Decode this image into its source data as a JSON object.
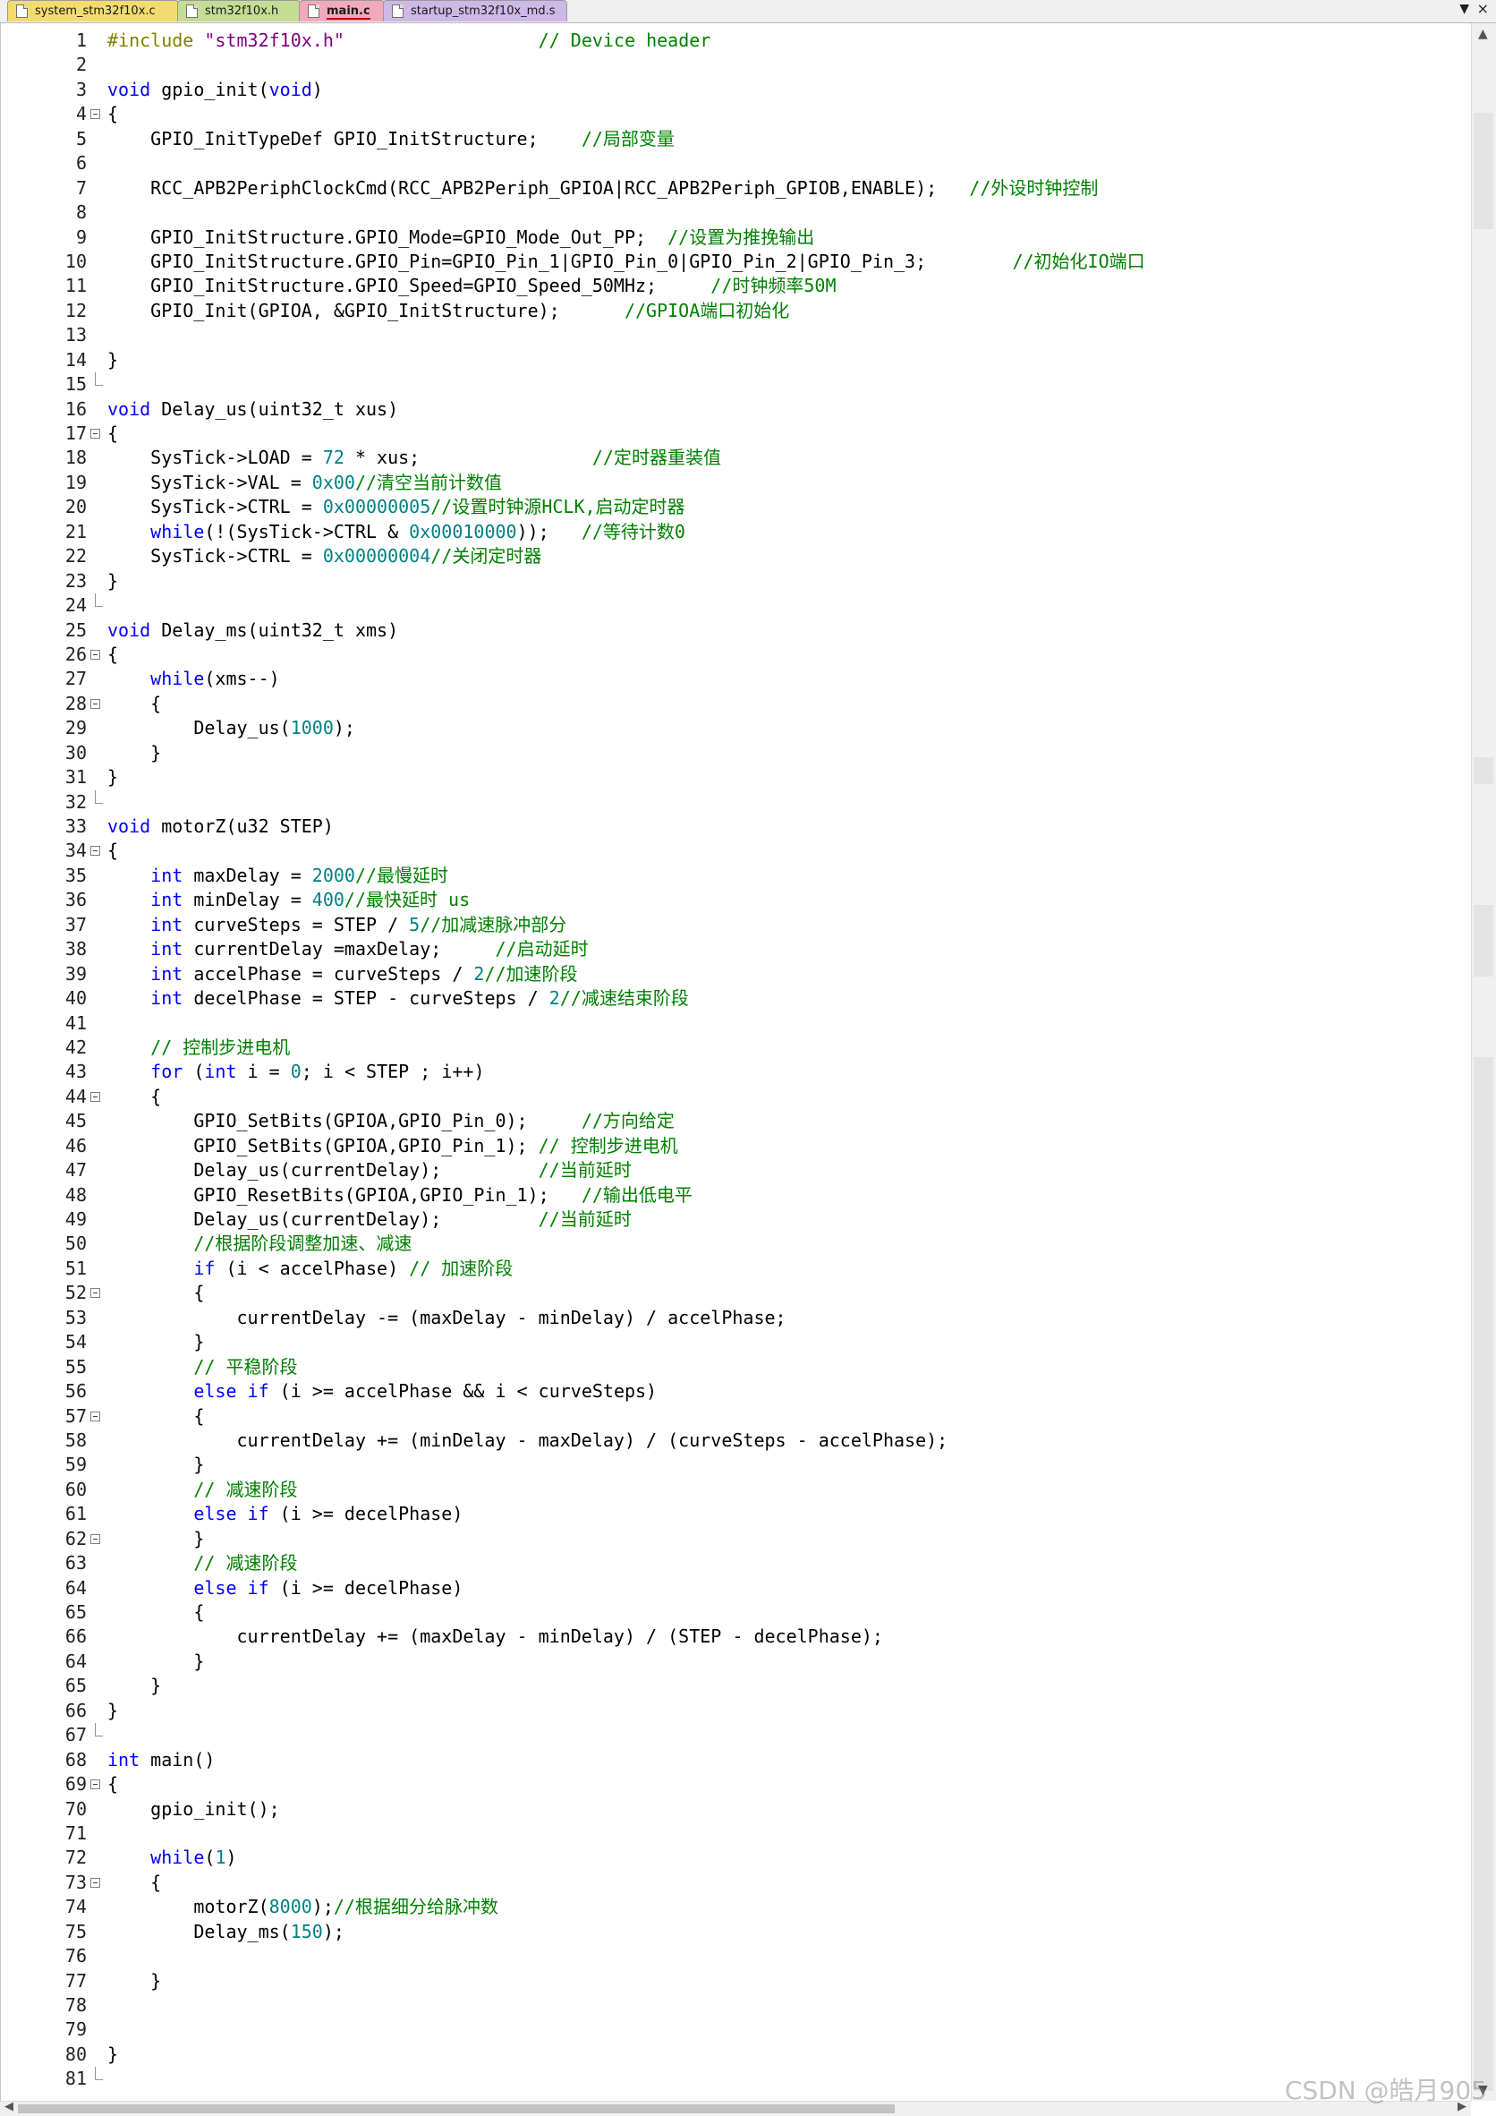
{
  "tabs": [
    {
      "label": "system_stm32f10x.c",
      "active": false,
      "color": "#f3db6e"
    },
    {
      "label": "stm32f10x.h",
      "active": false,
      "color": "#c4dc94"
    },
    {
      "label": "main.c",
      "active": true,
      "color": "#f2a9bd"
    },
    {
      "label": "startup_stm32f10x_md.s",
      "active": false,
      "color": "#cdb8e6"
    }
  ],
  "tab_dropdown_icon": "▼",
  "tab_close_icon": "×",
  "watermark": "CSDN @皓月905",
  "colors": {
    "keyword": "#0000ff",
    "preprocessor": "#808000",
    "string": "#800080",
    "number": "#008080",
    "comment": "#008000"
  },
  "code": [
    {
      "n": 1,
      "t": [
        [
          "pp",
          "#include "
        ],
        [
          "str",
          "\"stm32f10x.h\""
        ],
        [
          "",
          "                  "
        ],
        [
          "com",
          "// Device header"
        ]
      ]
    },
    {
      "n": 2,
      "t": []
    },
    {
      "n": 3,
      "t": [
        [
          "kw",
          "void"
        ],
        [
          "",
          " gpio_init("
        ],
        [
          "kw",
          "void"
        ],
        [
          "",
          ")"
        ]
      ]
    },
    {
      "n": 4,
      "fold": "open",
      "t": [
        [
          "",
          "{"
        ]
      ]
    },
    {
      "n": 5,
      "t": [
        [
          "",
          "    GPIO_InitTypeDef GPIO_InitStructure;    "
        ],
        [
          "com",
          "//局部变量"
        ]
      ]
    },
    {
      "n": 6,
      "t": []
    },
    {
      "n": 7,
      "t": [
        [
          "",
          "    RCC_APB2PeriphClockCmd(RCC_APB2Periph_GPIOA|RCC_APB2Periph_GPIOB,ENABLE);   "
        ],
        [
          "com",
          "//外设时钟控制"
        ]
      ]
    },
    {
      "n": 8,
      "t": []
    },
    {
      "n": 9,
      "t": [
        [
          "",
          "    GPIO_InitStructure.GPIO_Mode=GPIO_Mode_Out_PP;  "
        ],
        [
          "com",
          "//设置为推挽输出"
        ]
      ]
    },
    {
      "n": 10,
      "t": [
        [
          "",
          "    GPIO_InitStructure.GPIO_Pin=GPIO_Pin_1|GPIO_Pin_0|GPIO_Pin_2|GPIO_Pin_3;        "
        ],
        [
          "com",
          "//初始化IO端口"
        ]
      ]
    },
    {
      "n": 11,
      "t": [
        [
          "",
          "    GPIO_InitStructure.GPIO_Speed=GPIO_Speed_50MHz;     "
        ],
        [
          "com",
          "//时钟频率50M"
        ]
      ]
    },
    {
      "n": 12,
      "t": [
        [
          "",
          "    GPIO_Init(GPIOA, &GPIO_InitStructure);      "
        ],
        [
          "com",
          "//GPIOA端口初始化"
        ]
      ]
    },
    {
      "n": 13,
      "t": []
    },
    {
      "n": 14,
      "t": [
        [
          "",
          "}"
        ]
      ]
    },
    {
      "n": 15,
      "fold": "end",
      "t": []
    },
    {
      "n": 16,
      "t": [
        [
          "kw",
          "void"
        ],
        [
          "",
          " Delay_us(uint32_t xus)"
        ]
      ]
    },
    {
      "n": 17,
      "fold": "open",
      "t": [
        [
          "",
          "{"
        ]
      ]
    },
    {
      "n": 18,
      "t": [
        [
          "",
          "    SysTick->LOAD = "
        ],
        [
          "num",
          "72"
        ],
        [
          "",
          " * xus;                "
        ],
        [
          "com",
          "//定时器重装值"
        ]
      ]
    },
    {
      "n": 19,
      "t": [
        [
          "",
          "    SysTick->VAL = "
        ],
        [
          "num",
          "0x00"
        ],
        [
          ";                    "
        ],
        [
          "com",
          "//清空当前计数值"
        ]
      ]
    },
    {
      "n": 20,
      "t": [
        [
          "",
          "    SysTick->CTRL = "
        ],
        [
          "num",
          "0x00000005"
        ],
        [
          ";             "
        ],
        [
          "com",
          "//设置时钟源HCLK,启动定时器"
        ]
      ]
    },
    {
      "n": 21,
      "t": [
        [
          "",
          "    "
        ],
        [
          "kw",
          "while"
        ],
        [
          "",
          "(!(SysTick->CTRL & "
        ],
        [
          "num",
          "0x00010000"
        ],
        [
          "",
          "));   "
        ],
        [
          "com",
          "//等待计数0"
        ]
      ]
    },
    {
      "n": 22,
      "t": [
        [
          "",
          "    SysTick->CTRL = "
        ],
        [
          "num",
          "0x00000004"
        ],
        [
          ";             "
        ],
        [
          "com",
          "//关闭定时器"
        ]
      ]
    },
    {
      "n": 23,
      "t": [
        [
          "",
          "}"
        ]
      ]
    },
    {
      "n": 24,
      "fold": "end",
      "t": []
    },
    {
      "n": 25,
      "t": [
        [
          "kw",
          "void"
        ],
        [
          "",
          " Delay_ms(uint32_t xms)"
        ]
      ]
    },
    {
      "n": 26,
      "fold": "open",
      "t": [
        [
          "",
          "{"
        ]
      ]
    },
    {
      "n": 27,
      "t": [
        [
          "",
          "    "
        ],
        [
          "kw",
          "while"
        ],
        [
          "",
          "(xms--)"
        ]
      ]
    },
    {
      "n": 28,
      "fold": "open",
      "t": [
        [
          "",
          "    {"
        ]
      ]
    },
    {
      "n": 29,
      "t": [
        [
          "",
          "        Delay_us("
        ],
        [
          "num",
          "1000"
        ],
        [
          "",
          ");"
        ]
      ]
    },
    {
      "n": 30,
      "t": [
        [
          "",
          "    }"
        ]
      ]
    },
    {
      "n": 31,
      "t": [
        [
          "",
          "}"
        ]
      ]
    },
    {
      "n": 32,
      "fold": "end",
      "t": []
    },
    {
      "n": 33,
      "t": [
        [
          "kw",
          "void"
        ],
        [
          "",
          " motorZ(u32 STEP)"
        ]
      ]
    },
    {
      "n": 34,
      "fold": "open",
      "t": [
        [
          "",
          "{"
        ]
      ]
    },
    {
      "n": 35,
      "t": [
        [
          "",
          "    "
        ],
        [
          "kw",
          "int"
        ],
        [
          "",
          " maxDelay = "
        ],
        [
          "num",
          "2000"
        ],
        [
          ";    "
        ],
        [
          "com",
          "//最慢延时"
        ]
      ]
    },
    {
      "n": 36,
      "t": [
        [
          "",
          "    "
        ],
        [
          "kw",
          "int"
        ],
        [
          "",
          " minDelay = "
        ],
        [
          "num",
          "400"
        ],
        [
          ";        "
        ],
        [
          "com",
          "//最快延时 us"
        ]
      ]
    },
    {
      "n": 37,
      "t": [
        [
          "",
          "    "
        ],
        [
          "kw",
          "int"
        ],
        [
          "",
          " curveSteps = STEP / "
        ],
        [
          "num",
          "5"
        ],
        [
          ";  "
        ],
        [
          "com",
          "//加减速脉冲部分"
        ]
      ]
    },
    {
      "n": 38,
      "t": [
        [
          "",
          "    "
        ],
        [
          "kw",
          "int"
        ],
        [
          "",
          " currentDelay =maxDelay;     "
        ],
        [
          "com",
          "//启动延时"
        ]
      ]
    },
    {
      "n": 39,
      "t": [
        [
          "",
          "    "
        ],
        [
          "kw",
          "int"
        ],
        [
          "",
          " accelPhase = curveSteps / "
        ],
        [
          "num",
          "2"
        ],
        [
          ";  "
        ],
        [
          "com",
          "//加速阶段"
        ]
      ]
    },
    {
      "n": 40,
      "t": [
        [
          "",
          "    "
        ],
        [
          "kw",
          "int"
        ],
        [
          "",
          " decelPhase = STEP - curveSteps / "
        ],
        [
          "num",
          "2"
        ],
        [
          ";  "
        ],
        [
          "com",
          "//减速结束阶段"
        ]
      ]
    },
    {
      "n": 41,
      "t": []
    },
    {
      "n": 42,
      "t": [
        [
          "",
          "    "
        ],
        [
          "com",
          "// 控制步进电机"
        ]
      ]
    },
    {
      "n": 43,
      "t": [
        [
          "",
          "    "
        ],
        [
          "kw",
          "for"
        ],
        [
          "",
          " ("
        ],
        [
          "kw",
          "int"
        ],
        [
          "",
          " i = "
        ],
        [
          "num",
          "0"
        ],
        [
          "",
          "; i < STEP ; i++)"
        ]
      ]
    },
    {
      "n": 44,
      "fold": "open",
      "t": [
        [
          "",
          "    {"
        ]
      ]
    },
    {
      "n": 45,
      "t": [
        [
          "",
          "        GPIO_SetBits(GPIOA,GPIO_Pin_0);     "
        ],
        [
          "com",
          "//方向给定"
        ]
      ]
    },
    {
      "n": 46,
      "t": [
        [
          "",
          "        GPIO_SetBits(GPIOA,GPIO_Pin_1); "
        ],
        [
          "com",
          "// 控制步进电机"
        ]
      ]
    },
    {
      "n": 47,
      "t": [
        [
          "",
          "        Delay_us(currentDelay);         "
        ],
        [
          "com",
          "//当前延时"
        ]
      ]
    },
    {
      "n": 48,
      "t": [
        [
          "",
          "        GPIO_ResetBits(GPIOA,GPIO_Pin_1);   "
        ],
        [
          "com",
          "//输出低电平"
        ]
      ]
    },
    {
      "n": 49,
      "t": [
        [
          "",
          "        Delay_us(currentDelay);         "
        ],
        [
          "com",
          "//当前延时"
        ]
      ]
    },
    {
      "n": 50,
      "t": [
        [
          "",
          "        "
        ],
        [
          "com",
          "//根据阶段调整加速、减速"
        ]
      ]
    },
    {
      "n": 51,
      "t": [
        [
          "",
          "        "
        ],
        [
          "kw",
          "if"
        ],
        [
          "",
          " (i < accelPhase) "
        ],
        [
          "com",
          "// 加速阶段"
        ]
      ]
    },
    {
      "n": 52,
      "fold": "open",
      "t": [
        [
          "",
          "        {"
        ]
      ]
    },
    {
      "n": 53,
      "t": [
        [
          "",
          "            currentDelay -= (maxDelay - minDelay) / accelPhase;"
        ]
      ]
    },
    {
      "n": 54,
      "t": [
        [
          "",
          "        }"
        ]
      ]
    },
    {
      "n": 55,
      "t": [
        [
          "",
          "        "
        ],
        [
          "com",
          "// 平稳阶段"
        ]
      ]
    },
    {
      "n": 56,
      "t": [
        [
          "",
          "        "
        ],
        [
          "kw",
          "else if"
        ],
        [
          "",
          " (i >= accelPhase && i < curveSteps)"
        ]
      ]
    },
    {
      "n": 57,
      "fold": "open",
      "t": [
        [
          "",
          "        {"
        ]
      ]
    },
    {
      "n": 58,
      "t": [
        [
          "",
          "            currentDelay += (minDelay - maxDelay) / (curveSteps - accelPhase);"
        ]
      ]
    },
    {
      "n": 59,
      "t": [
        [
          "",
          "        }"
        ]
      ]
    },
    {
      "n": 60,
      "t": [
        [
          "",
          "        "
        ],
        [
          "com",
          "// 减速阶段"
        ]
      ]
    },
    {
      "n": 61,
      "t": [
        [
          "",
          "        "
        ],
        [
          "kw",
          "else if"
        ],
        [
          "",
          " (i >= decelPhase)"
        ]
      ]
    },
    {
      "n": 62,
      "fold": "open",
      "t": [
        [
          "",
          "        }"
        ]
      ]
    },
    {
      "n": 63,
      "t": [
        [
          "",
          "        "
        ],
        [
          "com",
          "// 减速阶段"
        ]
      ]
    },
    {
      "n": 64,
      "t": [
        [
          "",
          "        "
        ],
        [
          "kw",
          "else if"
        ],
        [
          "",
          " (i >= decelPhase)"
        ]
      ]
    },
    {
      "n": 65,
      "t": [
        [
          "",
          "        {"
        ]
      ]
    },
    {
      "n": 66,
      "t": [
        [
          "",
          "            currentDelay += (maxDelay - minDelay) / (STEP - decelPhase);"
        ]
      ]
    },
    {
      "n": 64,
      "t": [
        [
          "",
          "        }"
        ]
      ]
    },
    {
      "n": 65,
      "t": [
        [
          "",
          "    }"
        ]
      ]
    },
    {
      "n": 66,
      "t": [
        [
          "",
          "}"
        ]
      ]
    },
    {
      "n": 67,
      "fold": "end",
      "t": []
    },
    {
      "n": 68,
      "t": [
        [
          "kw",
          "int"
        ],
        [
          "",
          " main()"
        ]
      ]
    },
    {
      "n": 69,
      "fold": "open",
      "t": [
        [
          "",
          "{"
        ]
      ]
    },
    {
      "n": 70,
      "t": [
        [
          "",
          "    gpio_init();"
        ]
      ]
    },
    {
      "n": 71,
      "t": []
    },
    {
      "n": 72,
      "t": [
        [
          "",
          "    "
        ],
        [
          "kw",
          "while"
        ],
        [
          "",
          "("
        ],
        [
          "num",
          "1"
        ],
        [
          "",
          ")"
        ]
      ]
    },
    {
      "n": 73,
      "fold": "open",
      "t": [
        [
          "",
          "    {"
        ]
      ]
    },
    {
      "n": 74,
      "t": [
        [
          "",
          "        motorZ("
        ],
        [
          "num",
          "8000"
        ],
        [
          "",
          ");"
        ],
        [
          "com",
          "//根据细分给脉冲数"
        ]
      ]
    },
    {
      "n": 75,
      "t": [
        [
          "",
          "        Delay_ms("
        ],
        [
          "num",
          "150"
        ],
        [
          "",
          ");"
        ]
      ]
    },
    {
      "n": 76,
      "t": []
    },
    {
      "n": 77,
      "t": [
        [
          "",
          "    }"
        ]
      ]
    },
    {
      "n": 78,
      "t": []
    },
    {
      "n": 79,
      "t": []
    },
    {
      "n": 80,
      "t": [
        [
          "",
          "}"
        ]
      ]
    },
    {
      "n": 81,
      "fold": "end",
      "t": []
    }
  ]
}
